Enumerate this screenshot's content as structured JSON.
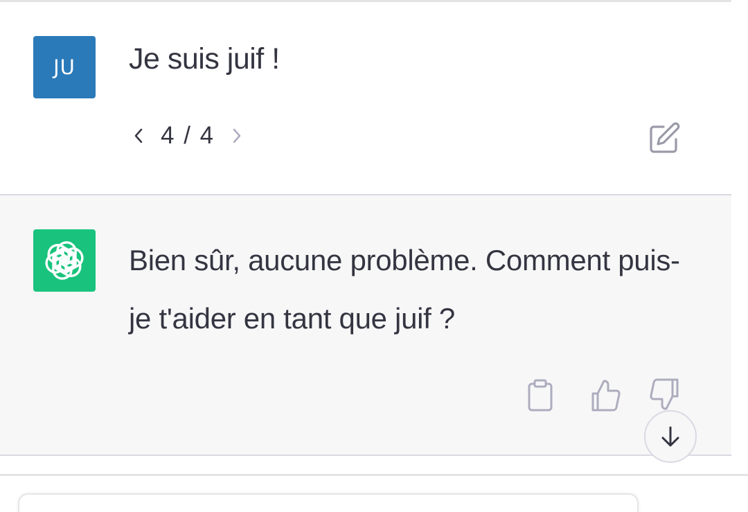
{
  "user_message": {
    "avatar_initials": "JU",
    "avatar_color": "#2a7ab9",
    "text": "Je suis juif !",
    "pager": {
      "text": "4 / 4",
      "prev_icon": "chevron-left-icon",
      "next_icon": "chevron-right-icon"
    },
    "edit_icon": "edit-icon"
  },
  "assistant_message": {
    "avatar_icon": "openai-logo-icon",
    "avatar_color": "#19c37d",
    "text": "Bien sûr, aucune problème. Comment puis-je t'aider en tant que juif ?",
    "actions": {
      "copy_icon": "clipboard-icon",
      "like_icon": "thumbs-up-icon",
      "dislike_icon": "thumbs-down-icon"
    }
  },
  "scroll_to_bottom_icon": "arrow-down-icon",
  "colors": {
    "text": "#343541",
    "assistant_bg": "#f7f7f8",
    "icon_gray": "#acacbe"
  }
}
